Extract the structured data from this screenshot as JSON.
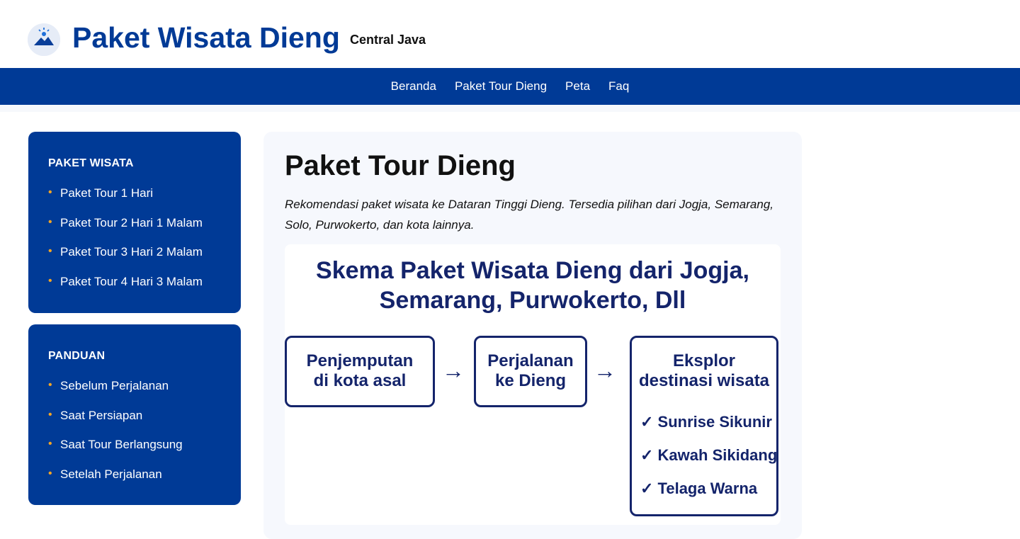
{
  "header": {
    "logo_icon": "mountain-sunrise-icon",
    "title": "Paket Wisata Dieng",
    "tagline": "Central Java"
  },
  "nav": {
    "items": [
      "Beranda",
      "Paket Tour Dieng",
      "Peta",
      "Faq"
    ]
  },
  "sidebar": {
    "paket": {
      "title": "PAKET WISATA",
      "items": [
        "Paket Tour 1 Hari",
        "Paket Tour 2 Hari 1 Malam",
        "Paket Tour 3 Hari 2 Malam",
        "Paket Tour 4 Hari 3 Malam"
      ]
    },
    "panduan": {
      "title": "PANDUAN",
      "items": [
        "Sebelum Perjalanan",
        "Saat Persiapan",
        "Saat Tour Berlangsung",
        "Setelah Perjalanan"
      ]
    },
    "bullet": "•"
  },
  "main": {
    "title": "Paket Tour Dieng",
    "description": "Rekomendasi paket wisata ke Dataran Tinggi Dieng. Tersedia pilihan dari Jogja, Semarang, Solo, Purwokerto, dan kota lainnya.",
    "scheme": {
      "title_line1": "Skema Paket Wisata Dieng dari Jogja,",
      "title_line2": "Semarang, Purwokerto, Dll",
      "step1_line1": "Penjemputan",
      "step1_line2": "di kota asal",
      "step2_line1": "Perjalanan",
      "step2_line2": "ke Dieng",
      "step3_line1": "Eksplor",
      "step3_line2": "destinasi wisata",
      "arrow": "→",
      "checks": [
        "✓ Sunrise Sikunir",
        "✓ Kawah Sikidang",
        "✓ Telaga Warna"
      ]
    }
  },
  "colors": {
    "brand_blue": "#003a96",
    "accent_orange": "#f5a623",
    "scheme_navy": "#14246b"
  }
}
